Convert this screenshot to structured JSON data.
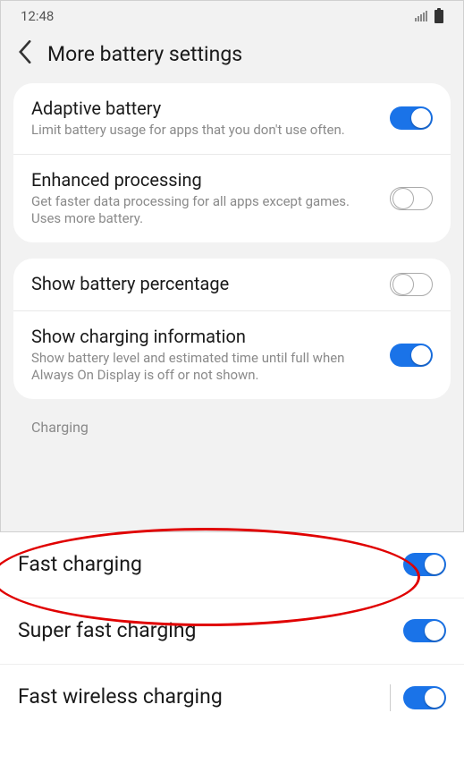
{
  "status": {
    "time": "12:48"
  },
  "header": {
    "title": "More battery settings"
  },
  "card1": {
    "adaptive": {
      "title": "Adaptive battery",
      "sub": "Limit battery usage for apps that you don't use often.",
      "on": true
    },
    "enhanced": {
      "title": "Enhanced processing",
      "sub": "Get faster data processing for all apps except games. Uses more battery.",
      "on": false
    }
  },
  "card2": {
    "percentage": {
      "title": "Show battery percentage",
      "on": false
    },
    "charginfo": {
      "title": "Show charging information",
      "sub": "Show battery level and estimated time until full when Always On Display is off or not shown.",
      "on": true
    }
  },
  "section": {
    "charging_label": "Charging"
  },
  "bottom": {
    "fast": {
      "title": "Fast charging",
      "on": true
    },
    "superfast": {
      "title": "Super fast charging",
      "on": true
    },
    "wireless": {
      "title": "Fast wireless charging",
      "on": true
    }
  }
}
